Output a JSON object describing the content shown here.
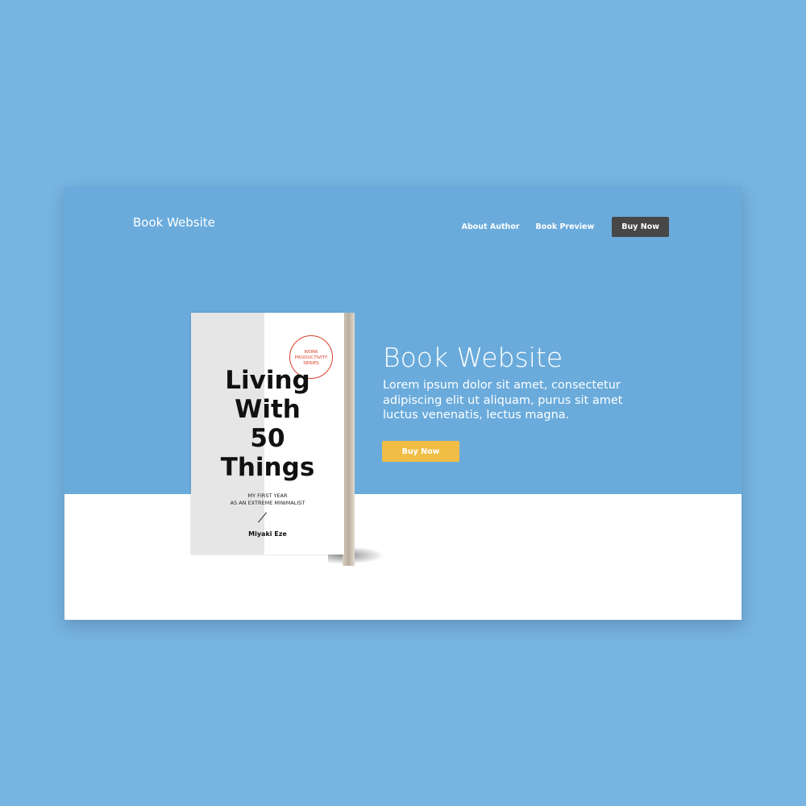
{
  "nav": {
    "logo": "Book Website",
    "links": [
      "About Author",
      "Book Preview"
    ],
    "buy": "Buy Now"
  },
  "hero": {
    "title": "Book Website",
    "description": "Lorem ipsum dolor sit amet, consectetur adipiscing elit ut aliquam, purus sit amet luctus venenatis, lectus magna.",
    "cta": "Buy Now"
  },
  "book": {
    "badge": "WORK PRODUCTIVITY SERIES",
    "title_lines": [
      "Living",
      "With",
      "50",
      "Things"
    ],
    "subtitle_lines": [
      "MY FIRST YEAR",
      "AS AN EXTREME MINIMALIST"
    ],
    "author": "Miyaki Eze"
  },
  "colors": {
    "background": "#76b4e1",
    "hero": "#6aabdc",
    "cta": "#f0bd45",
    "nav_button": "#474747"
  }
}
